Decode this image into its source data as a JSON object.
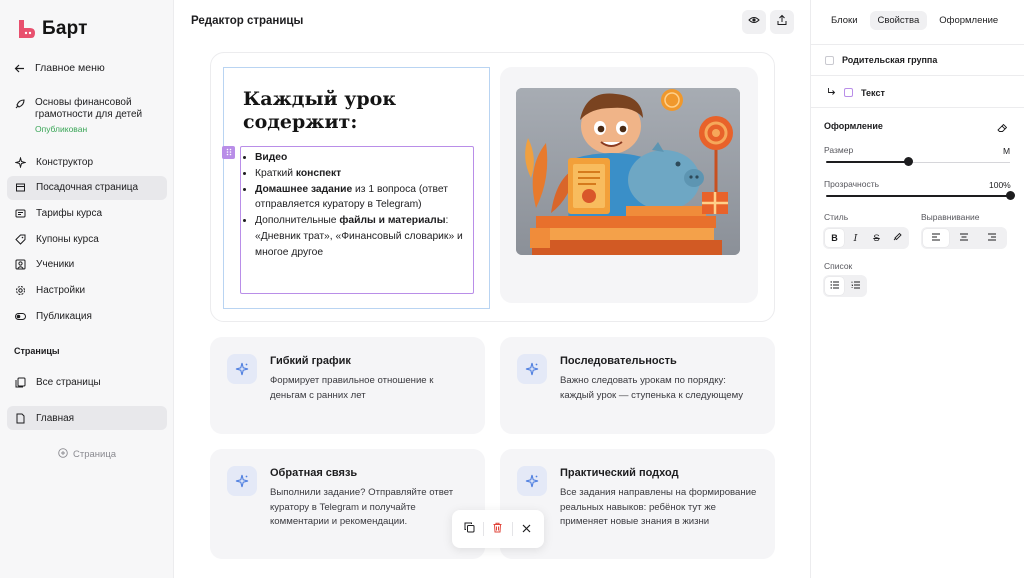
{
  "app": {
    "name": "Барт",
    "brand_color": "#e8506e"
  },
  "sidebar": {
    "back_label": "Главное меню",
    "course": {
      "title": "Основы финансовой грамотности для детей",
      "status": "Опубликован",
      "status_color": "#3aa657"
    },
    "items": [
      {
        "label": "Конструктор",
        "icon": "constructor-icon"
      },
      {
        "label": "Посадочная страница",
        "icon": "landing-page-icon",
        "active": true
      },
      {
        "label": "Тарифы курса",
        "icon": "tariffs-icon"
      },
      {
        "label": "Купоны курса",
        "icon": "coupons-icon"
      },
      {
        "label": "Ученики",
        "icon": "students-icon"
      },
      {
        "label": "Настройки",
        "icon": "settings-icon"
      },
      {
        "label": "Публикация",
        "icon": "publish-toggle-icon"
      }
    ],
    "pages_section_label": "Страницы",
    "pages": [
      {
        "label": "Все страницы",
        "icon": "all-pages-icon"
      },
      {
        "label": "Главная",
        "icon": "page-icon",
        "active": true
      }
    ],
    "add_page_label": "Страница"
  },
  "editor": {
    "title": "Редактор страницы",
    "hero": {
      "heading_line1": "Каждый урок",
      "heading_line2": "содержит:",
      "list": [
        {
          "bold": "Видео",
          "rest": ""
        },
        {
          "pre": "Краткий ",
          "bold": "конспект",
          "rest": ""
        },
        {
          "bold": "Домашнее задание",
          "rest": " из 1 вопроса (ответ отправляется куратору в Telegram)"
        },
        {
          "pre": "Дополнительные ",
          "bold": "файлы и материалы",
          "rest": ": «Дневник трат», «Финансовый словарик» и многое другое"
        }
      ]
    },
    "cards": [
      {
        "title": "Гибкий график",
        "desc": "Формирует правильное отношение к деньгам с ранних лет"
      },
      {
        "title": "Последовательность",
        "desc": "Важно следовать урокам по порядку: каждый урок — ступенька к следующему"
      },
      {
        "title": "Обратная связь",
        "desc": "Выполнили задание? Отправляйте ответ куратору в Telegram и получайте комментарии и рекомендации."
      },
      {
        "title": "Практический подход",
        "desc": "Все задания направлены на формирование реальных навыков: ребёнок тут же применяет новые знания в жизни"
      }
    ],
    "accent_color": "#b98ee8",
    "card_icon_color": "#4f7fe0"
  },
  "panel": {
    "tabs": [
      {
        "label": "Блоки"
      },
      {
        "label": "Свойства",
        "active": true
      },
      {
        "label": "Оформление"
      }
    ],
    "parent_group_label": "Родительская группа",
    "text_label": "Текст",
    "design_heading": "Оформление",
    "size_label": "Размер",
    "size_value": "M",
    "size_position": 0.45,
    "opacity_label": "Прозрачность",
    "opacity_value": "100%",
    "opacity_position": 1.0,
    "style_label": "Стиль",
    "align_label": "Выравнивание",
    "list_label": "Список"
  }
}
